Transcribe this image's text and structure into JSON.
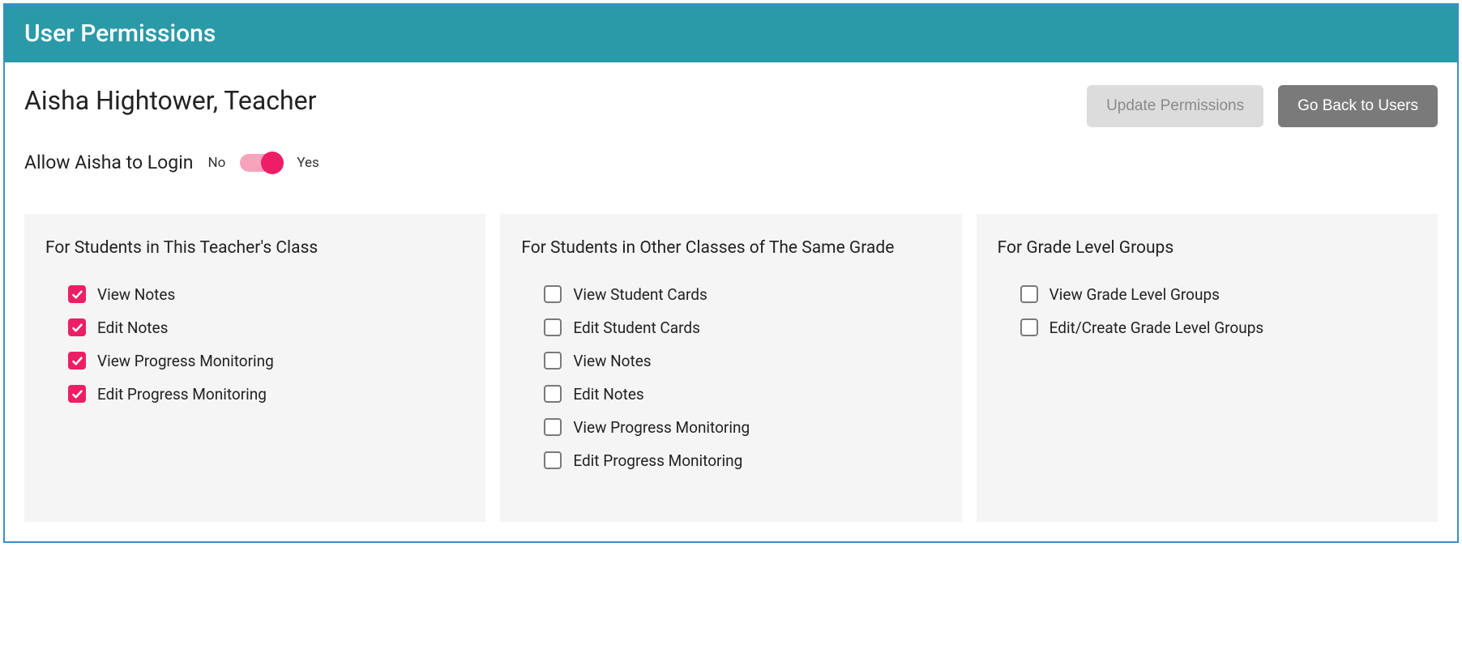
{
  "header": {
    "title": "User Permissions"
  },
  "user": {
    "display": "Aisha Hightower, Teacher"
  },
  "buttons": {
    "update": "Update Permissions",
    "back": "Go Back to Users"
  },
  "login": {
    "label": "Allow Aisha to Login",
    "no": "No",
    "yes": "Yes",
    "enabled": true
  },
  "panels": {
    "own_class": {
      "title": "For Students in This Teacher's Class",
      "items": [
        {
          "label": "View Notes",
          "checked": true
        },
        {
          "label": "Edit Notes",
          "checked": true
        },
        {
          "label": "View Progress Monitoring",
          "checked": true
        },
        {
          "label": "Edit Progress Monitoring",
          "checked": true
        }
      ]
    },
    "other_classes": {
      "title": "For Students in Other Classes of The Same Grade",
      "items": [
        {
          "label": "View Student Cards",
          "checked": false
        },
        {
          "label": "Edit Student Cards",
          "checked": false
        },
        {
          "label": "View Notes",
          "checked": false
        },
        {
          "label": "Edit Notes",
          "checked": false
        },
        {
          "label": "View Progress Monitoring",
          "checked": false
        },
        {
          "label": "Edit Progress Monitoring",
          "checked": false
        }
      ]
    },
    "grade_groups": {
      "title": "For Grade Level Groups",
      "items": [
        {
          "label": "View Grade Level Groups",
          "checked": false
        },
        {
          "label": "Edit/Create Grade Level Groups",
          "checked": false
        }
      ]
    }
  }
}
